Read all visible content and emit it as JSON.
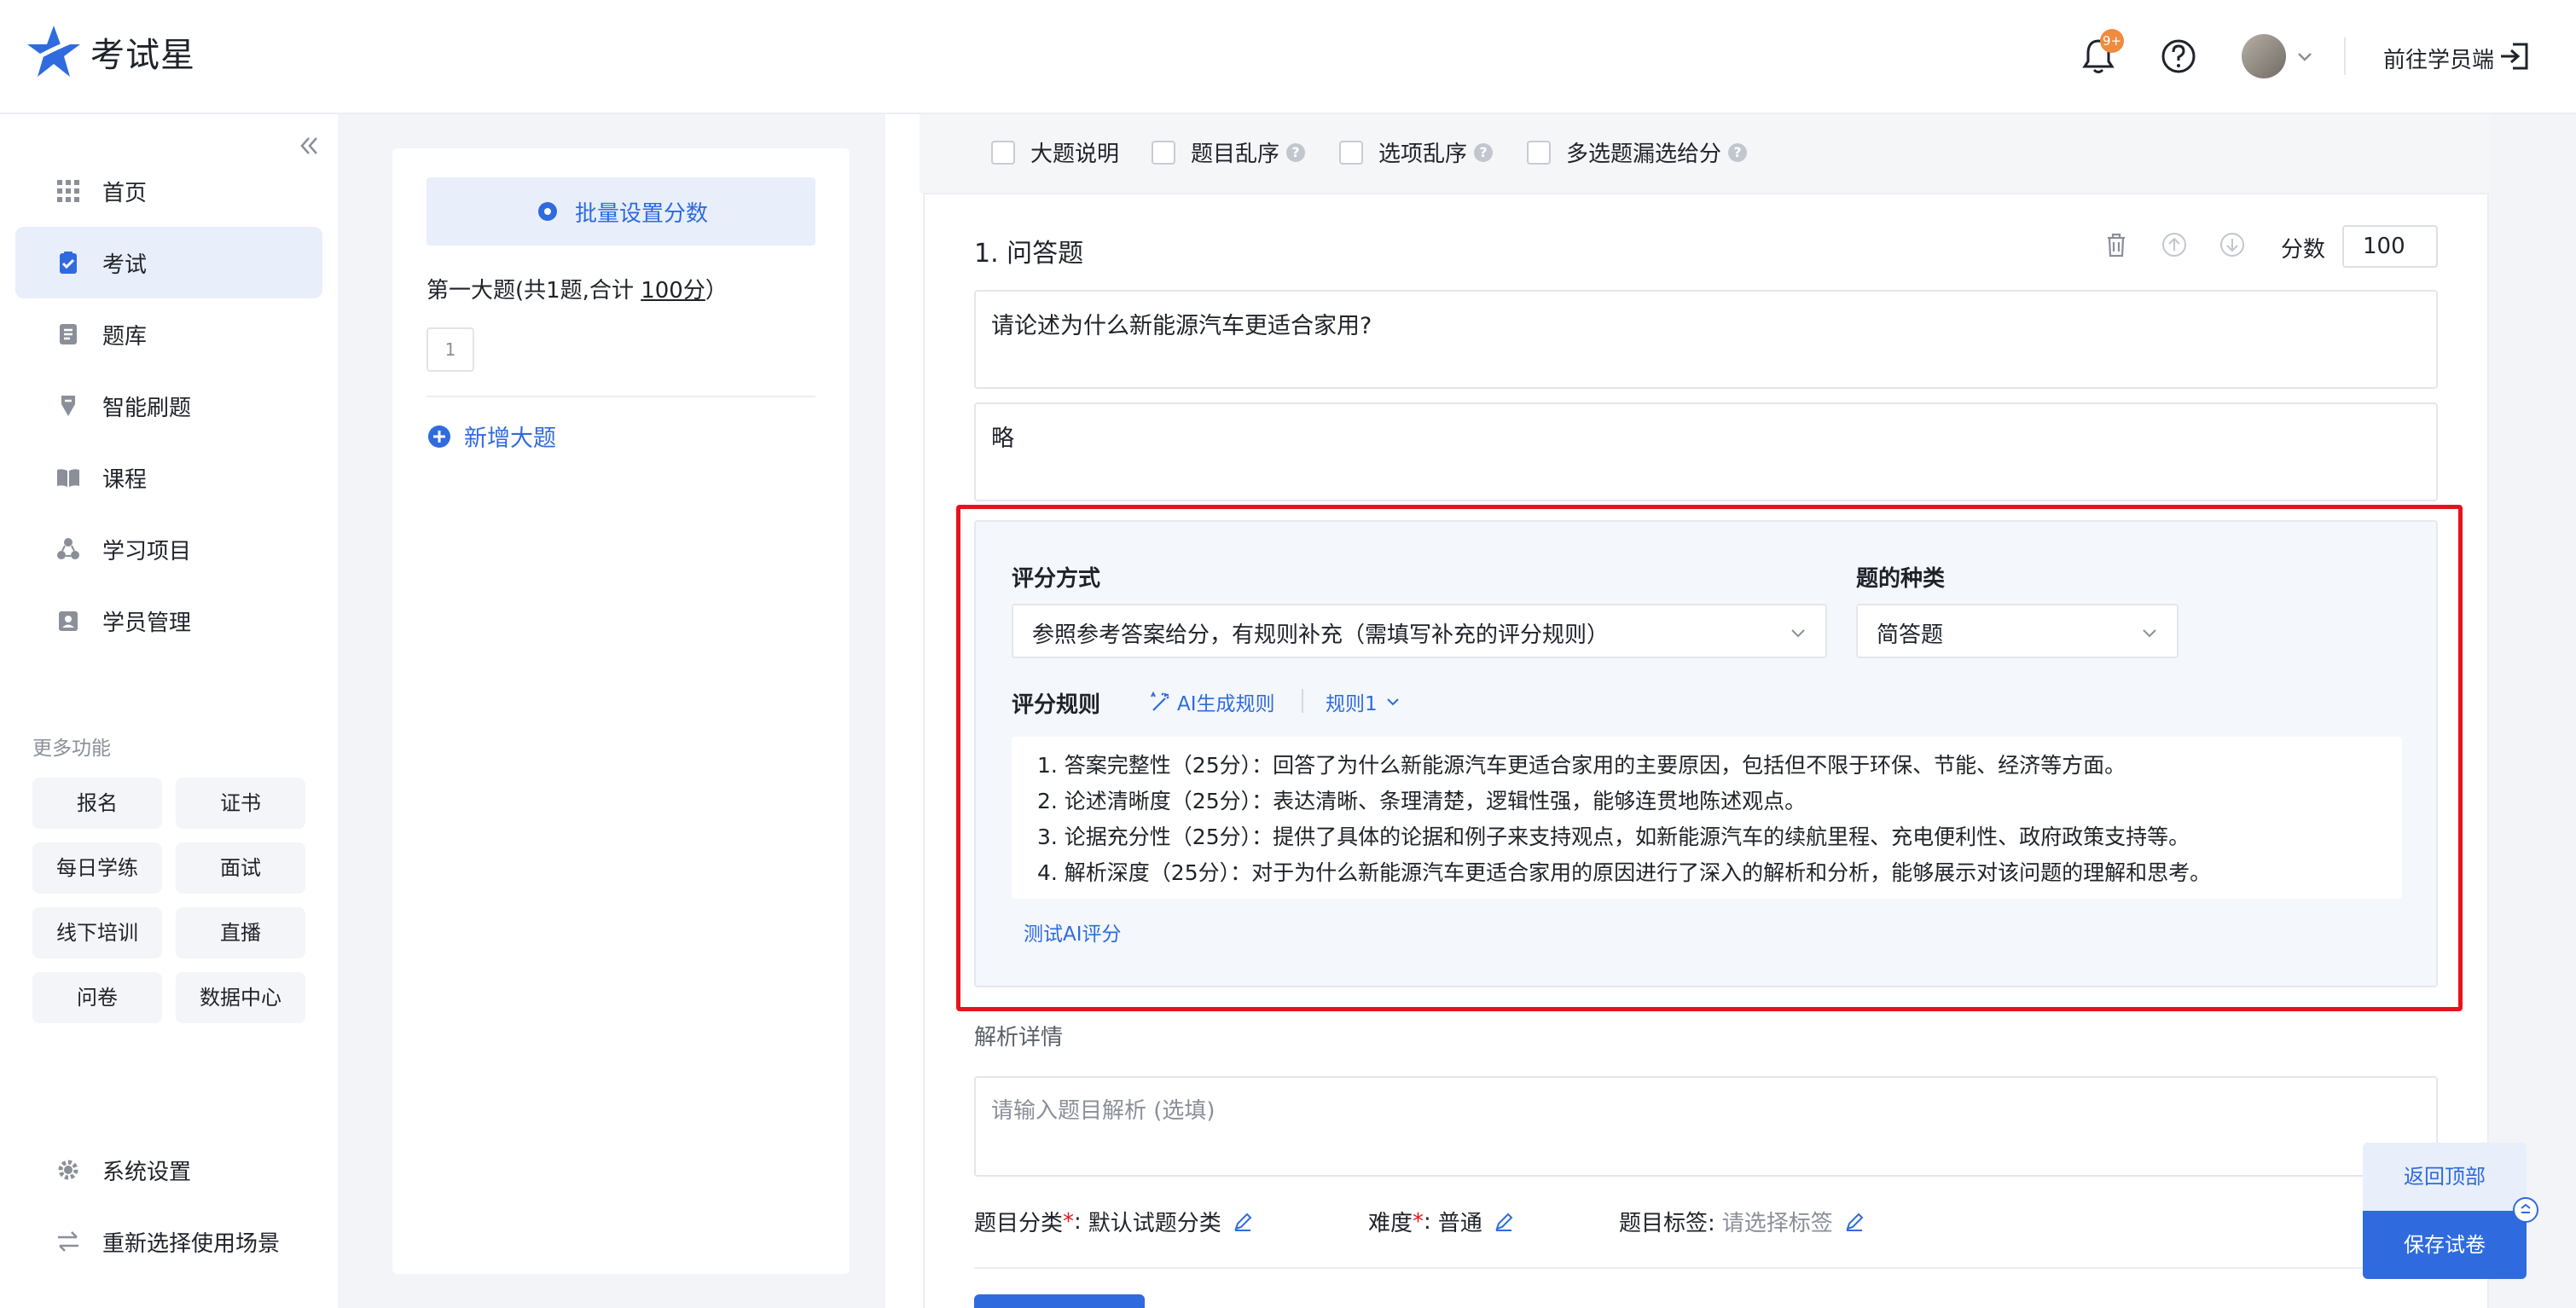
{
  "app": {
    "name": "考试星"
  },
  "header": {
    "notification_badge": "9+",
    "to_student": "前往学员端"
  },
  "sidebar": {
    "items": [
      {
        "label": "首页"
      },
      {
        "label": "考试"
      },
      {
        "label": "题库"
      },
      {
        "label": "智能刷题"
      },
      {
        "label": "课程"
      },
      {
        "label": "学习项目"
      },
      {
        "label": "学员管理"
      }
    ],
    "active_index": 1,
    "more_title": "更多功能",
    "more": [
      "报名",
      "证书",
      "每日学练",
      "面试",
      "线下培训",
      "直播",
      "问卷",
      "数据中心"
    ],
    "settings": "系统设置",
    "reselect": "重新选择使用场景"
  },
  "left_panel": {
    "batch_button": "批量设置分数",
    "section_prefix": "第一大题(共1题,合计 ",
    "section_score": "100分",
    "section_suffix": "）",
    "question_numbers": [
      "1"
    ],
    "add_section": "新增大题"
  },
  "options": {
    "section_desc": "大题说明",
    "shuffle_questions": "题目乱序",
    "shuffle_options": "选项乱序",
    "partial_score": "多选题漏选给分"
  },
  "question": {
    "title": "1. 问答题",
    "score_label": "分数",
    "score": "100",
    "stem": "请论述为什么新能源汽车更适合家用?",
    "answer": "略"
  },
  "scoring": {
    "method_label": "评分方式",
    "method_value": "参照参考答案给分，有规则补充（需填写补充的评分规则）",
    "type_label": "题的种类",
    "type_value": "简答题",
    "rules_label": "评分规则",
    "ai_generate": "AI生成规则",
    "rule_select": "规则1",
    "rules": [
      "1. 答案完整性（25分）：回答了为什么新能源汽车更适合家用的主要原因，包括但不限于环保、节能、经济等方面。",
      "2. 论述清晰度（25分）：表达清晰、条理清楚，逻辑性强，能够连贯地陈述观点。",
      "3. 论据充分性（25分）：提供了具体的论据和例子来支持观点，如新能源汽车的续航里程、充电便利性、政府政策支持等。",
      "4. 解析深度（25分）：对于为什么新能源汽车更适合家用的原因进行了深入的解析和分析，能够展示对该问题的理解和思考。"
    ],
    "test_ai": "测试AI评分"
  },
  "analysis": {
    "title": "解析详情",
    "placeholder": "请输入题目解析 (选填)"
  },
  "meta": {
    "category_label": "题目分类",
    "category_value": "默认试题分类",
    "difficulty_label": "难度",
    "difficulty_value": "普通",
    "tags_label": "题目标签:",
    "tags_placeholder": "请选择标签",
    "required_mark": "*",
    "colon": ":"
  },
  "floating": {
    "back_top": "返回顶部",
    "save": "保存试卷"
  },
  "colors": {
    "primary": "#2f6bdf",
    "highlight": "#e5141b",
    "badge": "#f08a3e"
  }
}
